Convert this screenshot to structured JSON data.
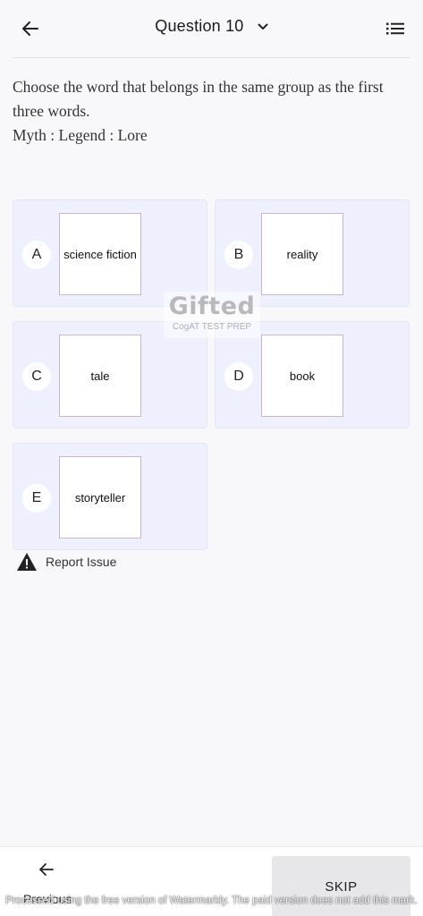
{
  "header": {
    "title": "Question 10"
  },
  "question": {
    "prompt": "Choose the word that belongs in the same group as the first three words.",
    "stem": "Myth : Legend : Lore"
  },
  "options": [
    {
      "letter": "A",
      "text": "science fiction"
    },
    {
      "letter": "B",
      "text": "reality"
    },
    {
      "letter": "C",
      "text": "tale"
    },
    {
      "letter": "D",
      "text": "book"
    },
    {
      "letter": "E",
      "text": "storyteller"
    }
  ],
  "watermark": {
    "title": "Gifted",
    "subtitle": "CogAT TEST PREP",
    "note": "Processed using the free version of Watermarkly. The paid version does not add this mark."
  },
  "report": {
    "label": "Report Issue"
  },
  "footer": {
    "previous_label": "Previous",
    "skip_label": "SKIP"
  },
  "colors": {
    "option_bg": "#eef0fe",
    "card_border": "#c9b3d8",
    "skip_bg": "#e7e7e9"
  }
}
